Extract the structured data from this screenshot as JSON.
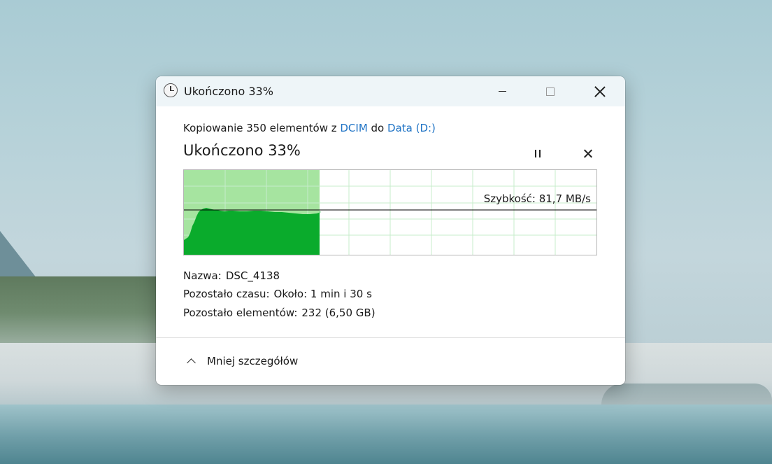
{
  "window": {
    "title": "Ukończono 33%"
  },
  "copy": {
    "prefix": "Kopiowanie 350 elementów z ",
    "source": "DCIM",
    "middle": " do ",
    "destination": "Data (D:)"
  },
  "status": {
    "title": "Ukończono 33%",
    "progress_percent": 33
  },
  "graph": {
    "speed_label": "Szybkość: 81,7 MB/s",
    "colors": {
      "done_fill": "#a6e4a0",
      "area_fill": "#0aab2c",
      "grid": "#c7eccb",
      "speed_line": "#000000"
    }
  },
  "details": {
    "name_label": "Nazwa:",
    "name_value": "DSC_4138",
    "time_label": "Pozostało czasu:",
    "time_value": "Około: 1 min i 30 s",
    "items_label": "Pozostało elementów:",
    "items_value": "232 (6,50 GB)"
  },
  "footer": {
    "toggle_label": "Mniej szczegółów"
  },
  "icons": [
    "clock-icon",
    "minimize-icon",
    "maximize-icon",
    "close-icon",
    "pause-icon",
    "cancel-icon",
    "chevron-up-icon"
  ]
}
